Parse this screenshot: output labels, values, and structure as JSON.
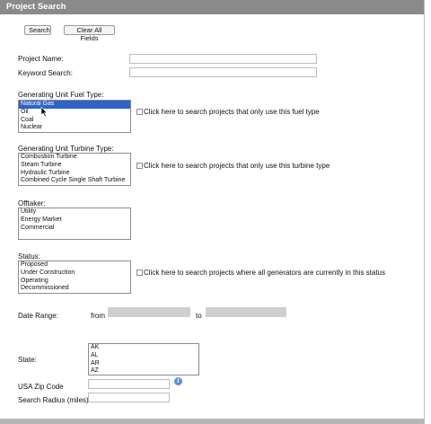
{
  "header": {
    "title": "Project Search"
  },
  "toolbar": {
    "search_label": "Search",
    "clear_label": "Clear All Fields"
  },
  "fields": {
    "project_name": {
      "label": "Project Name:",
      "value": ""
    },
    "keyword": {
      "label": "Keyword Search:",
      "value": ""
    }
  },
  "fuel_type": {
    "label": "Generating Unit Fuel Type:",
    "options": [
      "Natural Gas",
      "Oil",
      "Coal",
      "Nuclear"
    ],
    "selected": "Natural Gas",
    "checkbox_label": "Click here to search projects that only use this fuel type"
  },
  "turbine_type": {
    "label": "Generating Unit Turbine Type:",
    "options": [
      "Combustion Turbine",
      "Steam Turbine",
      "Hydraulic Turbine",
      "Combined Cycle Single Shaft Turbine"
    ],
    "checkbox_label": "Click here to search projects that only use this turbine type"
  },
  "offtaker": {
    "label": "Offtaker:",
    "options": [
      "Utility",
      "Energy Market",
      "Commercial"
    ]
  },
  "status": {
    "label": "Status:",
    "options": [
      "Proposed",
      "Under Construction",
      "Operating",
      "Decommissioned"
    ],
    "checkbox_label": "Click here to search projects where all generators are currently in this status"
  },
  "date_range": {
    "label": "Date Range:",
    "from_label": "from",
    "to_label": "to",
    "from_value": "",
    "to_value": ""
  },
  "state": {
    "label": "State:",
    "options": [
      "AK",
      "AL",
      "AR",
      "AZ"
    ]
  },
  "zip": {
    "label": "USA Zip Code",
    "value": "",
    "info_icon": "info-icon"
  },
  "radius": {
    "label": "Search Radius (miles)",
    "value": ""
  }
}
